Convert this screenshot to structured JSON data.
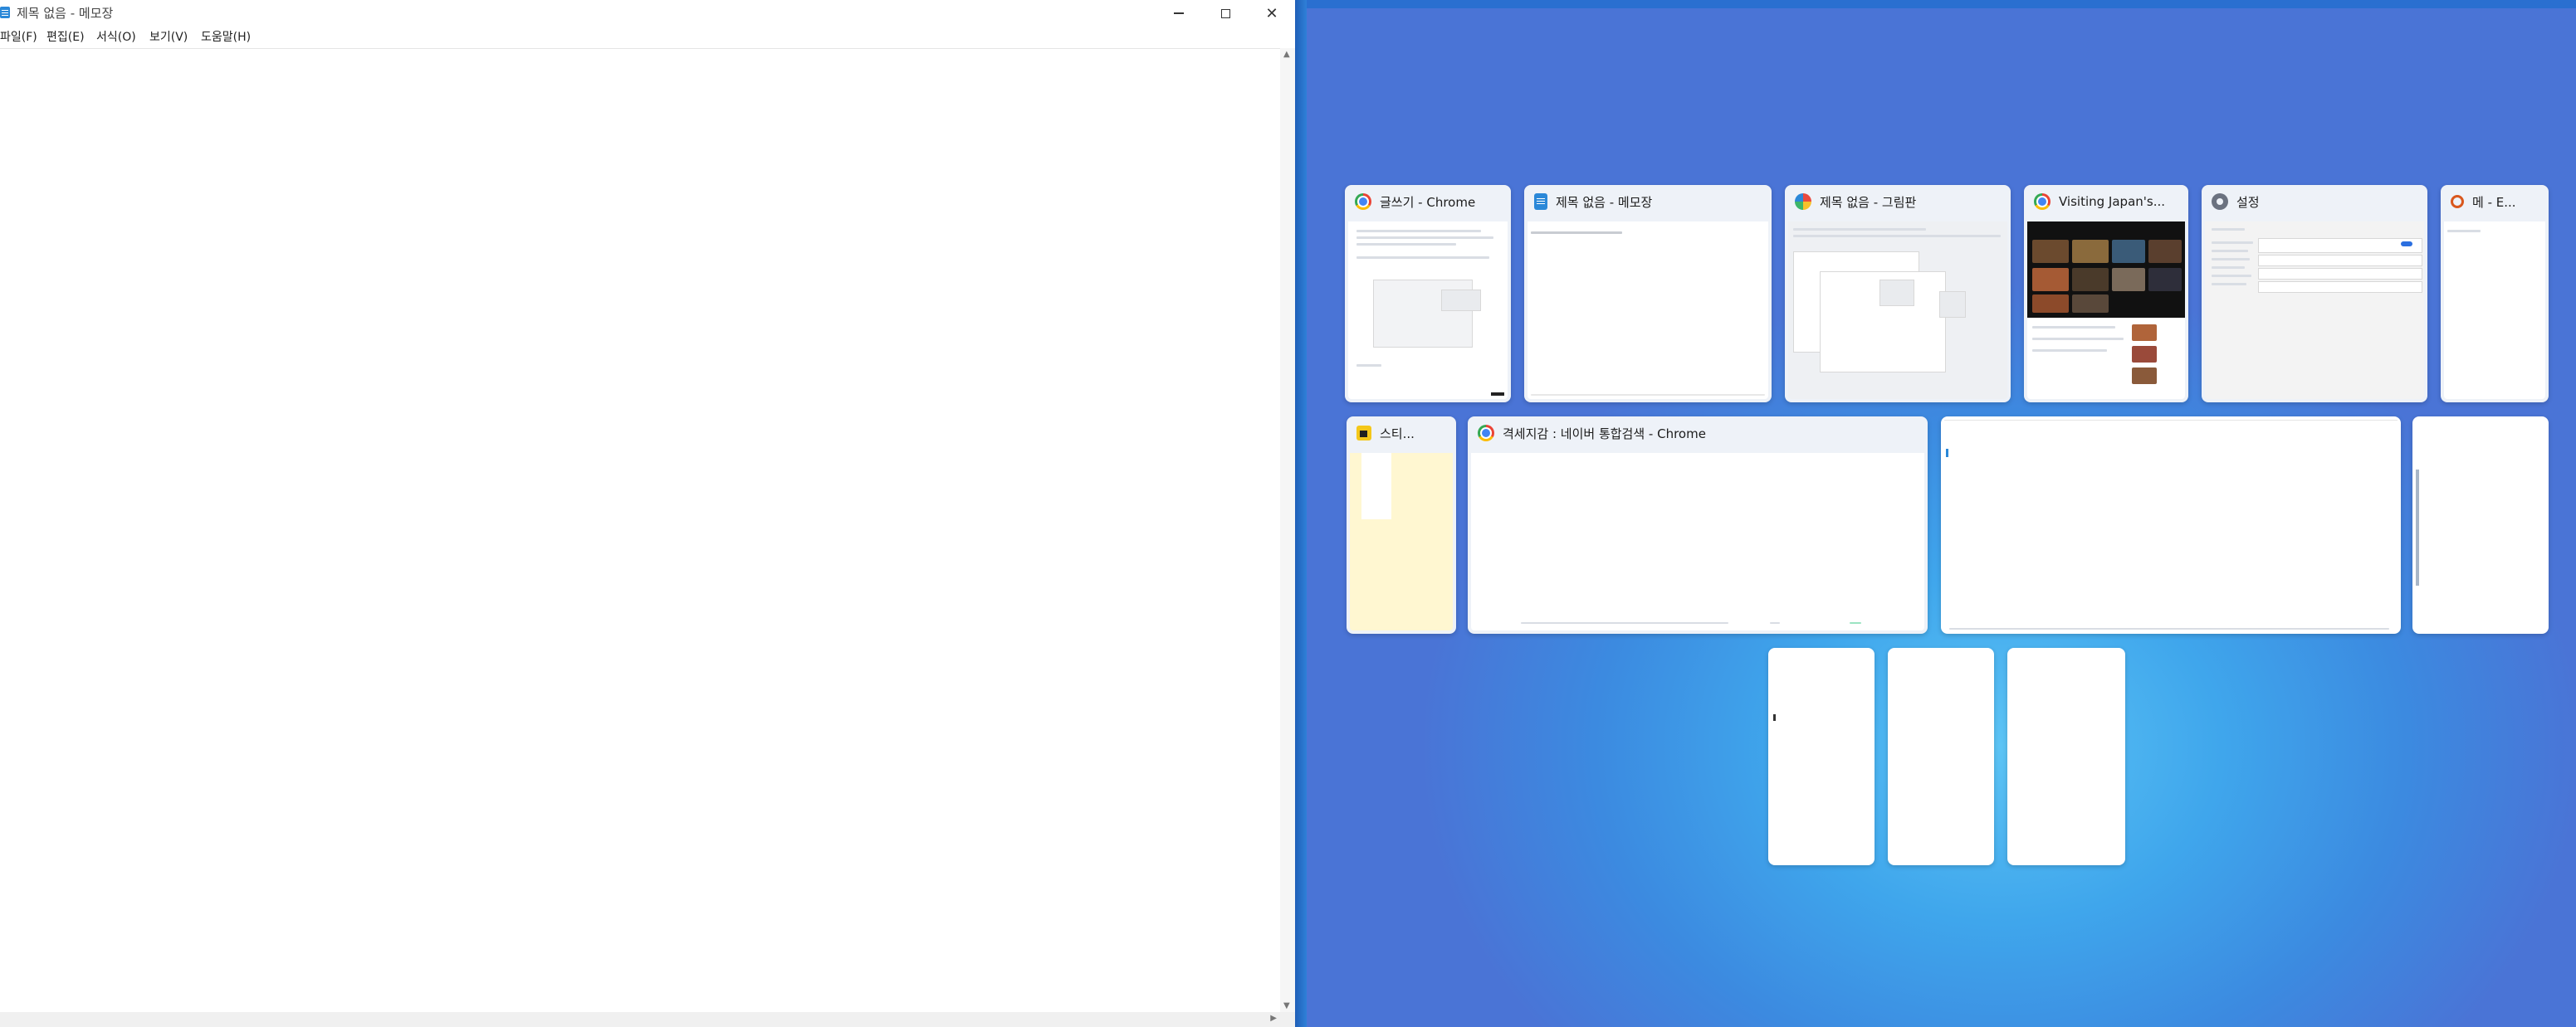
{
  "notepad": {
    "title": "제목 없음 - 메모장",
    "menu": [
      "파일(F)",
      "편집(E)",
      "서식(O)",
      "보기(V)",
      "도움말(H)"
    ],
    "window_buttons": {
      "minimize": "—",
      "close": "✕"
    },
    "icons": {
      "app": "notepad-icon",
      "minimize": "minimize-icon",
      "maximize": "maximize-icon",
      "close": "close-icon"
    }
  },
  "snap_assist": {
    "windows": [
      {
        "title": "글쓰기 - Chrome",
        "icon": "chrome-icon"
      },
      {
        "title": "제목 없음 - 메모장",
        "icon": "notepad-icon"
      },
      {
        "title": "제목 없음 - 그림판",
        "icon": "paint-icon"
      },
      {
        "title": "Visiting Japan's...",
        "icon": "chrome-icon"
      },
      {
        "title": "설정",
        "icon": "settings-icon"
      },
      {
        "title": "메 - E...",
        "icon": "search-icon"
      },
      {
        "title": "스티...",
        "icon": "sticky-notes-icon"
      },
      {
        "title": "격세지감 : 네이버 통합검색 - Chrome",
        "icon": "chrome-icon"
      },
      {
        "title": "",
        "icon": ""
      },
      {
        "title": "",
        "icon": ""
      },
      {
        "title": "",
        "icon": ""
      },
      {
        "title": "",
        "icon": ""
      },
      {
        "title": "",
        "icon": ""
      }
    ]
  }
}
